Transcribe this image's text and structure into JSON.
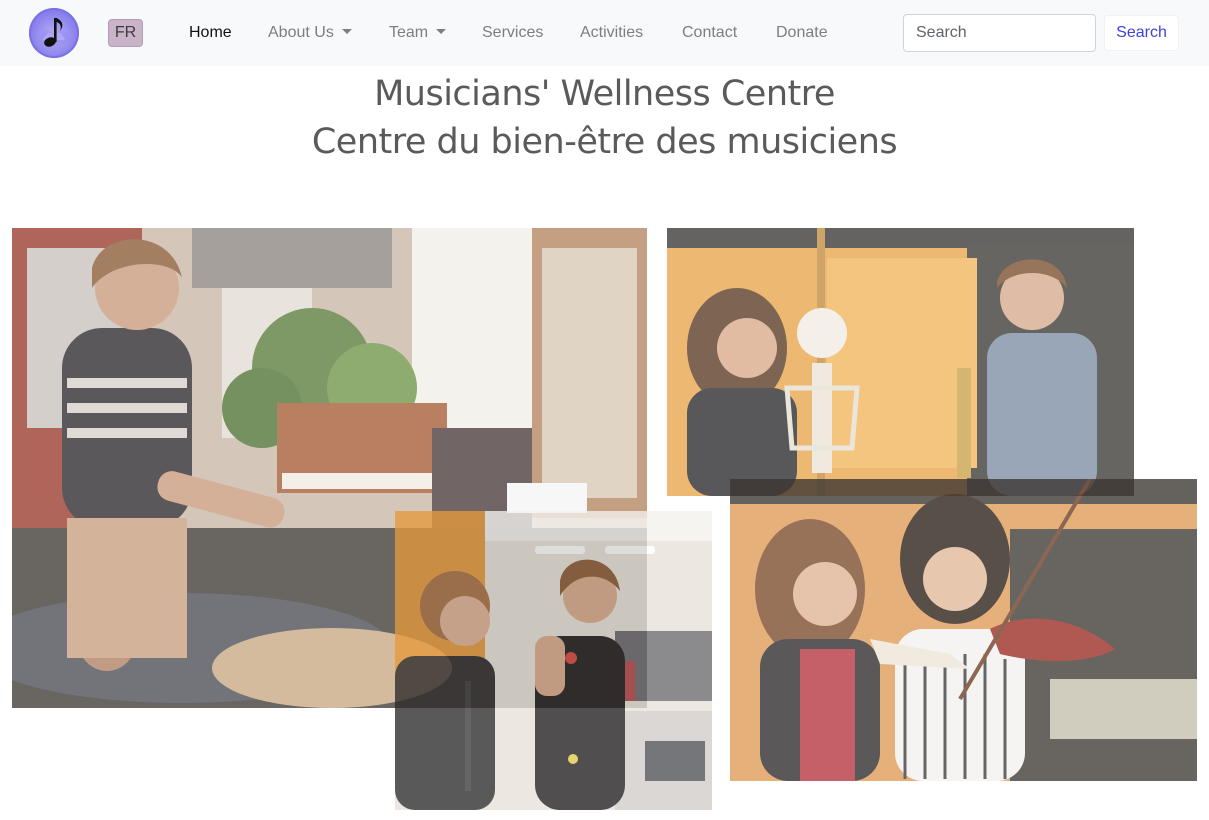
{
  "navbar": {
    "logo_icon": "music-note-lotus-icon",
    "lang_label": "FR",
    "items": [
      {
        "label": "Home",
        "active": true
      },
      {
        "label": "About Us",
        "dropdown": true
      },
      {
        "label": "Team",
        "dropdown": true
      },
      {
        "label": "Services"
      },
      {
        "label": "Activities"
      },
      {
        "label": "Contact"
      },
      {
        "label": "Donate"
      }
    ],
    "search_placeholder": "Search",
    "search_button": "Search"
  },
  "page": {
    "title_en": "Musicians' Wellness Centre",
    "title_fr": "Centre du bien-être des musiciens"
  },
  "photos": [
    {
      "name": "physio-session-piano-room"
    },
    {
      "name": "skeleton-saxophone-lesson"
    },
    {
      "name": "posture-markers-session"
    },
    {
      "name": "violin-arm-skeleton-demo"
    }
  ],
  "colors": {
    "navbar_bg": "#f8f9fa",
    "accent": "#3f41e0",
    "title": "#5a5a5a",
    "lang_badge": "#c9b3c8"
  }
}
